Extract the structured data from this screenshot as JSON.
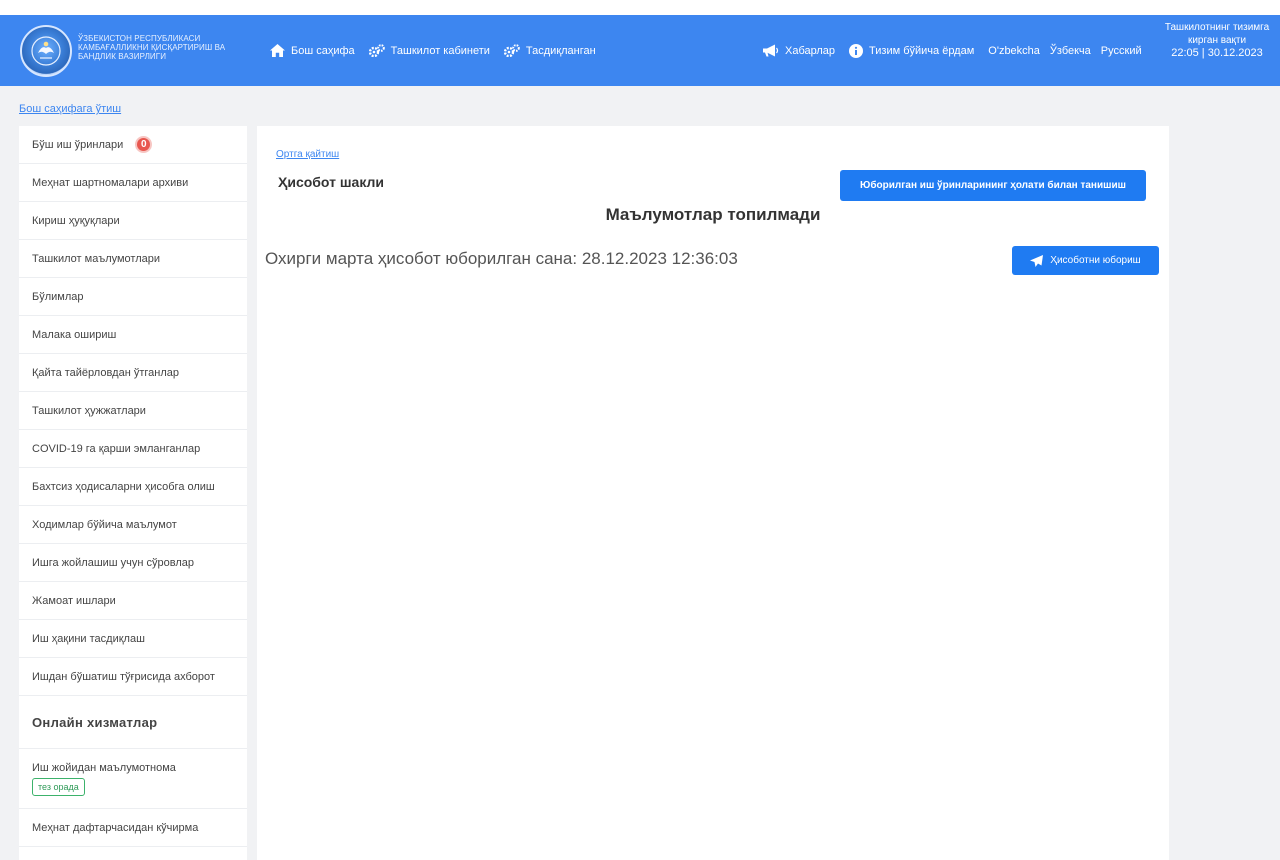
{
  "header": {
    "logo_text": "ЎЗБЕКИСТОН РЕСПУБЛИКАСИ КАМБАҒАЛЛИКНИ ҚИСҚАРТИРИШ ВА БАНДЛИК ВАЗИРЛИГИ",
    "nav_left": [
      {
        "label": "Бош саҳифа",
        "icon": "home-icon"
      },
      {
        "label": "Ташкилот кабинети",
        "icon": "gears-icon"
      },
      {
        "label": "Тасдиқланган",
        "icon": "gears-icon"
      }
    ],
    "nav_right": [
      {
        "label": "Хабарлар",
        "icon": "megaphone-icon"
      },
      {
        "label": "Тизим бўйича ёрдам",
        "icon": "info-icon"
      }
    ],
    "languages": [
      "O'zbekcha",
      "Ўзбекча",
      "Русский"
    ],
    "clock": {
      "label": "Ташкилотнинг тизимга кирган вақти",
      "value": "22:05 | 30.12.2023"
    }
  },
  "breadcrumb_home": "Бош саҳифага ўтиш",
  "sidebar": {
    "items": [
      {
        "label": "Бўш иш ўринлари",
        "badge": "0"
      },
      {
        "label": "Меҳнат шартномалари архиви"
      },
      {
        "label": "Кириш ҳуқуқлари"
      },
      {
        "label": "Ташкилот маълумотлари"
      },
      {
        "label": "Бўлимлар"
      },
      {
        "label": "Малака ошириш"
      },
      {
        "label": "Қайта тайёрловдан ўтганлар"
      },
      {
        "label": "Ташкилот ҳужжатлари"
      },
      {
        "label": "COVID-19 га қарши эмланганлар"
      },
      {
        "label": "Бахтсиз ҳодисаларни ҳисобга олиш"
      },
      {
        "label": "Ходимлар бўйича маълумот"
      },
      {
        "label": "Ишга жойлашиш учун сўровлар"
      },
      {
        "label": "Жамоат ишлари"
      },
      {
        "label": "Иш ҳақини тасдиқлаш"
      },
      {
        "label": "Ишдан бўшатиш тўғрисида ахборот"
      }
    ],
    "section_title": "Онлайн хизматлар",
    "online_items": [
      {
        "label": "Иш жойидан маълумотнома",
        "tag": "тез орада"
      },
      {
        "label": "Меҳнат дафтарчасидан кўчирма"
      }
    ]
  },
  "panel": {
    "back_link": "Ортга қайтиш",
    "form_title": "Ҳисобот шакли",
    "status_button": "Юборилган иш ўринларининг ҳолати билан танишиш",
    "not_found": "Маълумотлар топилмади",
    "last_sent": "Охирги марта ҳисобот юборилган сана: 28.12.2023 12:36:03",
    "send_button": "Ҳисоботни юбориш"
  },
  "colors": {
    "header_bg": "#3d86f0",
    "button_bg": "#1f7bf2",
    "badge": "#e8574f",
    "soon_tag": "#3cb26b"
  }
}
